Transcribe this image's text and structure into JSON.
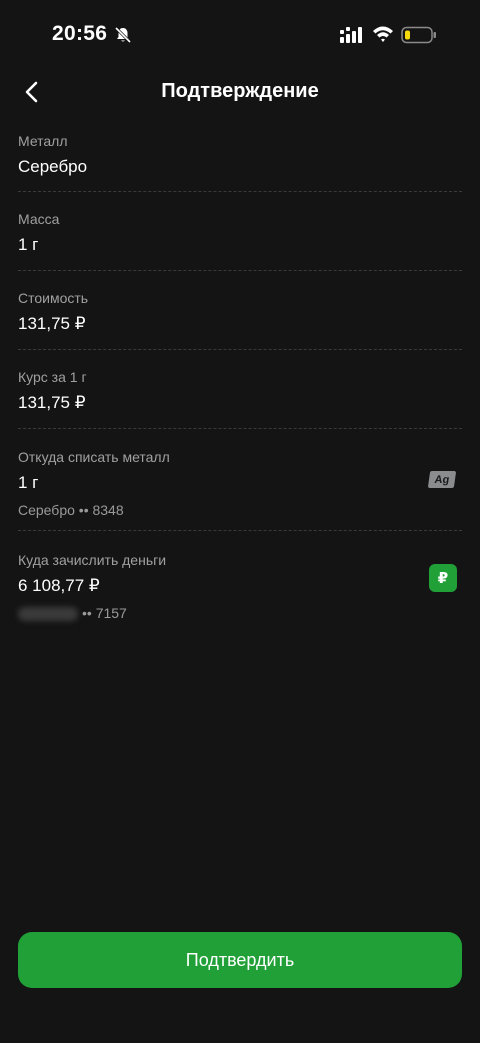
{
  "status_bar": {
    "time": "20:56"
  },
  "header": {
    "title": "Подтверждение"
  },
  "fields": {
    "metal": {
      "label": "Металл",
      "value": "Серебро"
    },
    "mass": {
      "label": "Масса",
      "value": "1 г"
    },
    "cost": {
      "label": "Стоимость",
      "value": "131,75 ₽"
    },
    "rate": {
      "label": "Курс за 1 г",
      "value": "131,75 ₽"
    },
    "source": {
      "label": "Откуда списать металл",
      "value": "1 г",
      "account": "Серебро •• 8348",
      "badge": "Ag"
    },
    "destination": {
      "label": "Куда зачислить деньги",
      "value": "6 108,77 ₽",
      "account": "•• 7157",
      "badge": "₽"
    }
  },
  "actions": {
    "confirm_label": "Подтвердить"
  },
  "colors": {
    "background": "#141414",
    "accent": "#21a038"
  },
  "icons": [
    "bell-slash-icon",
    "signal-icon",
    "wifi-icon",
    "battery-icon",
    "back-arrow-icon"
  ]
}
